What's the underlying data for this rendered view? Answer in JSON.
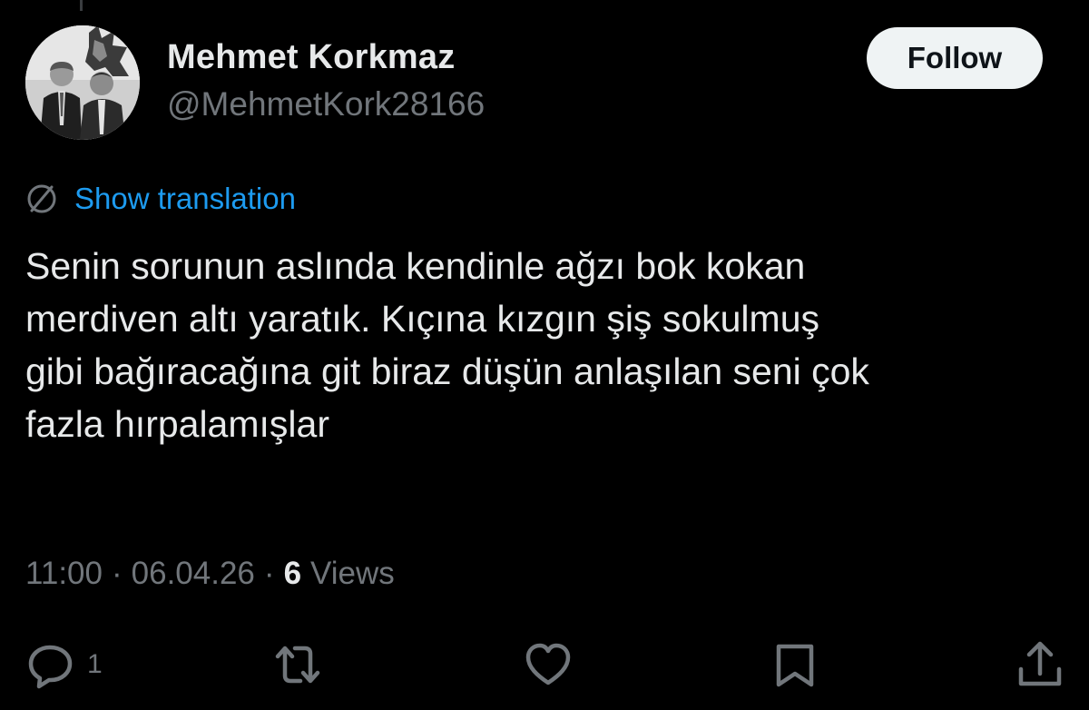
{
  "author": {
    "display_name": "Mehmet Korkmaz",
    "handle": "@MehmetKork28166"
  },
  "follow_button": {
    "label": "Follow"
  },
  "translation": {
    "label": "Show translation"
  },
  "tweet": {
    "lines": [
      "Senin sorunun aslında kendinle ağzı bok kokan",
      "merdiven altı yaratık. Kıçına kızgın şiş sokulmuş",
      "gibi bağıracağına git biraz düşün anlaşılan seni çok",
      "fazla hırpalamışlar"
    ]
  },
  "meta": {
    "time": "11:00",
    "separator": "·",
    "date": "06.04.26",
    "views_count": "6",
    "views_label": "Views"
  },
  "actions": {
    "reply_count": "1"
  },
  "colors": {
    "background": "#000000",
    "text_primary": "#e7e9ea",
    "text_secondary": "#71767b",
    "link": "#1d9bf0",
    "follow_bg": "#eff3f4"
  },
  "icons": [
    "globe-icon",
    "reply-icon",
    "retweet-icon",
    "like-icon",
    "bookmark-icon",
    "share-icon"
  ]
}
